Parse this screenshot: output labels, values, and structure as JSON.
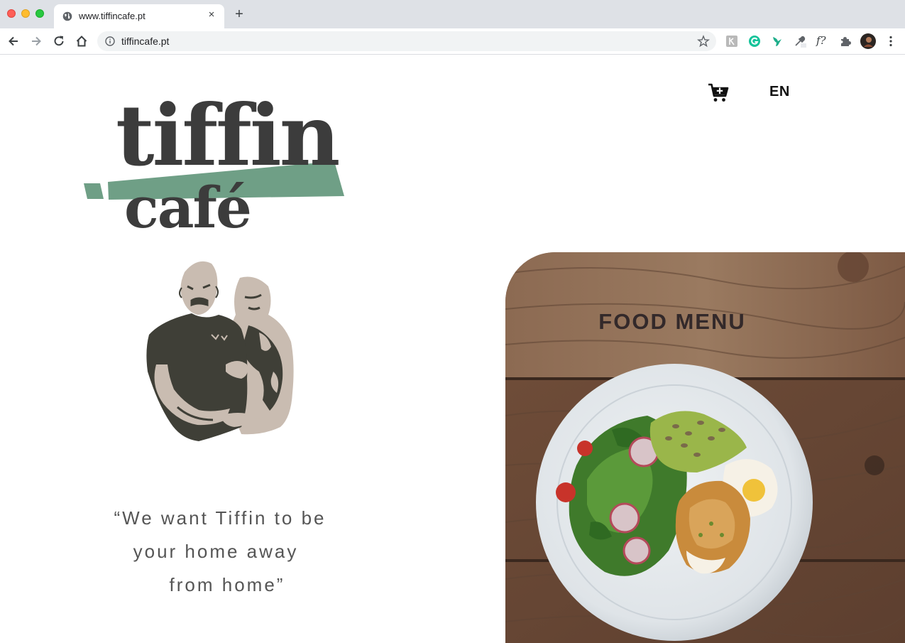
{
  "browser": {
    "tab_title": "www.tiffincafe.pt",
    "tab_close": "×",
    "new_tab": "+",
    "url": "tiffincafe.pt",
    "icons": [
      "back-icon",
      "forward-icon",
      "reload-icon",
      "home-icon",
      "info-icon",
      "bookmark-star-icon",
      "extension-icon",
      "grammarly-icon",
      "bird-extension-icon",
      "eyedropper-icon",
      "font-finder-icon",
      "puzzle-icon",
      "profile-avatar",
      "more-icon"
    ],
    "font_ext_label": "f?"
  },
  "header": {
    "language": "EN",
    "cart_icon": "cart-add-icon"
  },
  "logo": {
    "line1": "tiffin",
    "line2": "café",
    "accent_color": "#6f9f86"
  },
  "quote": {
    "line1": "“We want Tiffin to be",
    "line2": "your home away",
    "line3": "from home”"
  },
  "food_card": {
    "title": "FOOD MENU"
  },
  "colors": {
    "text_dark": "#3c3c3c",
    "portrait_dark": "#3f3f37",
    "portrait_light": "#c9bcb1",
    "wood": "#7a5a43"
  }
}
